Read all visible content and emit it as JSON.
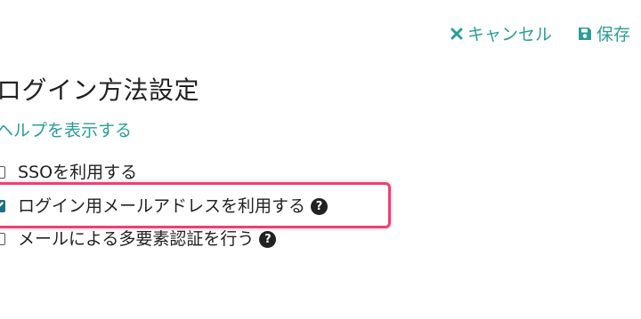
{
  "toolbar": {
    "cancel_label": "キャンセル",
    "save_label": "保存",
    "cancel_icon": "close-icon",
    "save_icon": "floppy-disk-icon"
  },
  "page": {
    "title": "ログイン方法設定",
    "help_link": "ヘルプを表示する"
  },
  "options": [
    {
      "label": "SSOを利用する",
      "checked": false,
      "has_help": false
    },
    {
      "label": "ログイン用メールアドレスを利用する",
      "checked": true,
      "has_help": true
    },
    {
      "label": "メールによる多要素認証を行う",
      "checked": false,
      "has_help": true
    }
  ],
  "colors": {
    "accent": "#2a9d98",
    "checkbox_checked": "#1f6f8b",
    "highlight": "#ef3f72",
    "text": "#222222"
  }
}
